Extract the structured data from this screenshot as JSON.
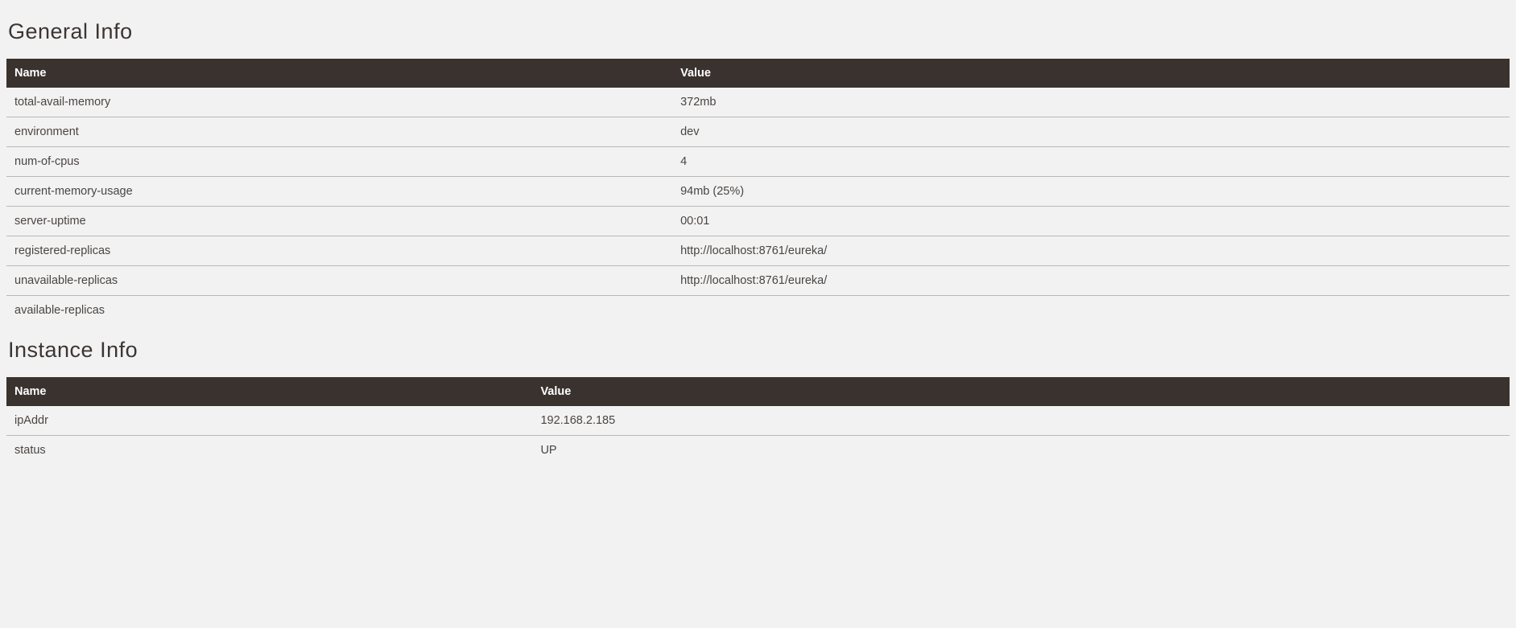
{
  "general": {
    "title": "General Info",
    "headers": {
      "name": "Name",
      "value": "Value"
    },
    "rows": [
      {
        "name": "total-avail-memory",
        "value": "372mb"
      },
      {
        "name": "environment",
        "value": "dev"
      },
      {
        "name": "num-of-cpus",
        "value": "4"
      },
      {
        "name": "current-memory-usage",
        "value": "94mb (25%)"
      },
      {
        "name": "server-uptime",
        "value": "00:01"
      },
      {
        "name": "registered-replicas",
        "value": "http://localhost:8761/eureka/"
      },
      {
        "name": "unavailable-replicas",
        "value": "http://localhost:8761/eureka/"
      },
      {
        "name": "available-replicas",
        "value": ""
      }
    ]
  },
  "instance": {
    "title": "Instance Info",
    "headers": {
      "name": "Name",
      "value": "Value"
    },
    "rows": [
      {
        "name": "ipAddr",
        "value": "192.168.2.185"
      },
      {
        "name": "status",
        "value": "UP"
      }
    ]
  }
}
